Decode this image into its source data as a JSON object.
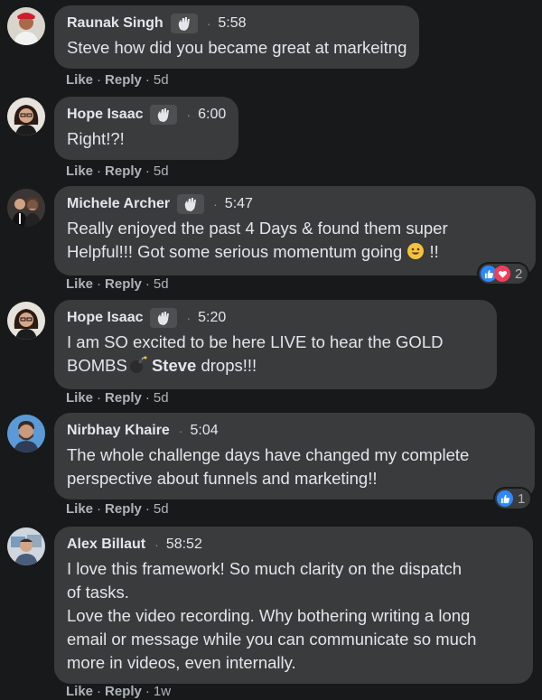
{
  "comments": [
    {
      "name": "Raunak Singh",
      "time": "5:58",
      "dot": "·",
      "text": [
        "Steve how did you became great at markeitng"
      ],
      "actions": {
        "like": "Like",
        "reply": "Reply",
        "age": "5d"
      }
    },
    {
      "name": "Hope Isaac",
      "time": "6:00",
      "dot": "·",
      "text": [
        "Right!?!"
      ],
      "actions": {
        "like": "Like",
        "reply": "Reply",
        "age": "5d"
      }
    },
    {
      "name": "Michele Archer",
      "time": "5:47",
      "dot": "·",
      "text": [
        "Really enjoyed the past 4 Days & found them super",
        "Helpful!!! Got some serious momentum going",
        "!!"
      ],
      "reactions": {
        "count": "2"
      },
      "actions": {
        "like": "Like",
        "reply": "Reply",
        "age": "5d"
      }
    },
    {
      "name": "Hope Isaac",
      "time": "5:20",
      "dot": "·",
      "text": [
        "I am SO excited to be here LIVE to hear the GOLD",
        "BOMBS",
        "Steve",
        "drops!!!"
      ],
      "actions": {
        "like": "Like",
        "reply": "Reply",
        "age": "5d"
      }
    },
    {
      "name": "Nirbhay Khaire",
      "time": "5:04",
      "dot": "·",
      "text": [
        "The whole challenge days have changed my complete",
        "perspective about funnels and marketing!!"
      ],
      "reactions": {
        "count": "1"
      },
      "actions": {
        "like": "Like",
        "reply": "Reply",
        "age": "5d"
      }
    },
    {
      "name": "Alex Billaut",
      "time": "58:52",
      "dot": "·",
      "text": [
        "I love this framework! So much clarity on the dispatch",
        "of tasks.",
        "Love the video recording. Why bothering writing a long",
        "email or message while you can communicate so much",
        "more in videos, even internally."
      ],
      "actions": {
        "like": "Like",
        "reply": "Reply",
        "age": "1w"
      }
    }
  ],
  "sep": "·",
  "colors": {
    "background": "#18191a",
    "bubble": "#3a3b3c",
    "text": "#e4e6eb",
    "muted": "#b0b3b8",
    "like_blue": "#2d88ff",
    "love_red": "#f33e58"
  },
  "icons": [
    "waving-hand-icon",
    "smiley-emoji-icon",
    "bomb-emoji-icon",
    "like-reaction-icon",
    "love-reaction-icon"
  ]
}
